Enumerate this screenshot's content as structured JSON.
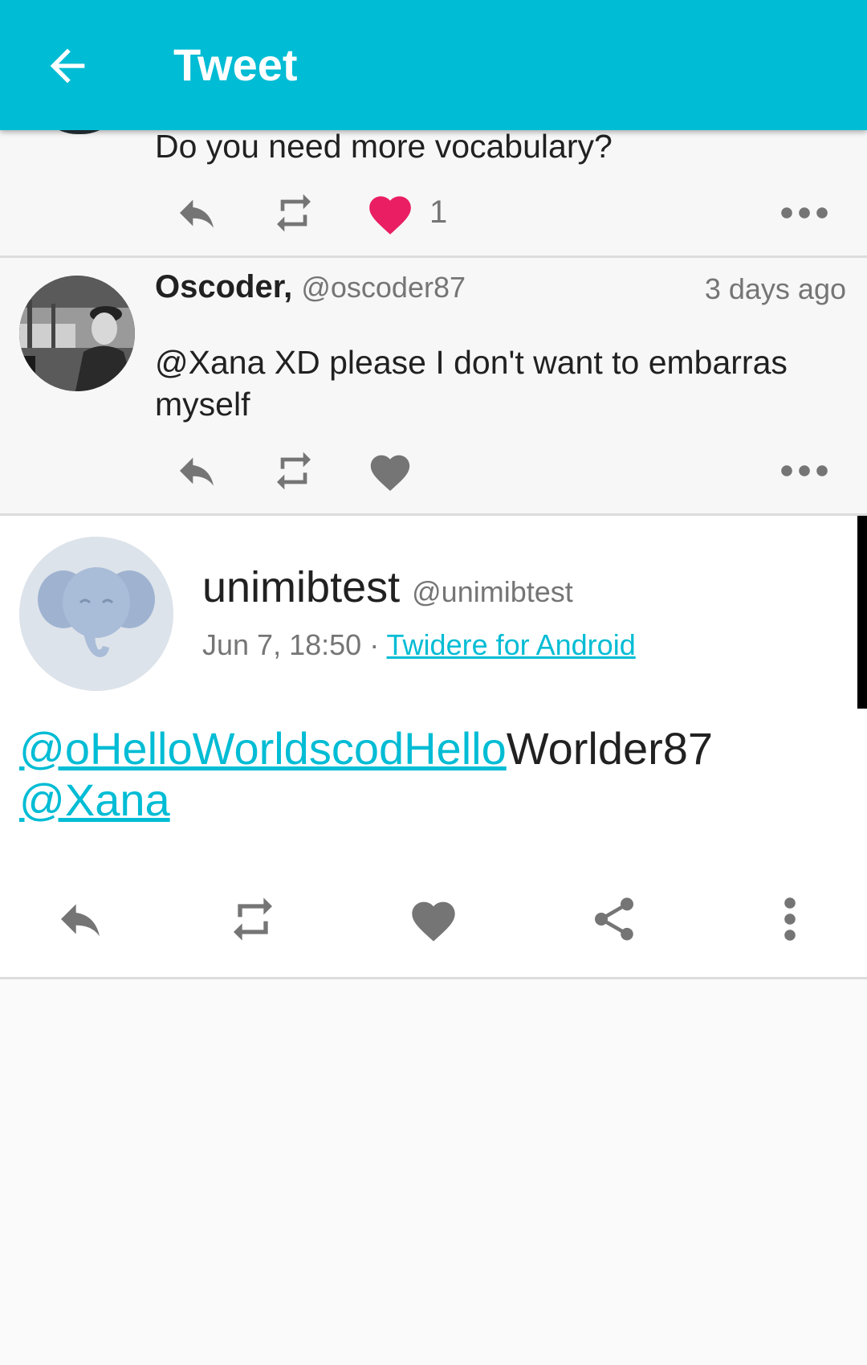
{
  "appbar": {
    "title": "Tweet",
    "back_icon": "arrow-back-icon",
    "color": "#00bcd4"
  },
  "tweet_prev": {
    "text": "Do you need more vocabulary?",
    "like_count": "1",
    "liked": true,
    "like_color": "#e91e63"
  },
  "tweet_reply": {
    "name": "Oscoder,",
    "handle": "@oscoder87",
    "time": "3 days ago",
    "text_line1": "@Xana XD please I don't want to embarras",
    "text_line2": "myself"
  },
  "main_tweet": {
    "name": "unimibtest",
    "handle": "@unimibtest",
    "date": "Jun 7, 18:50",
    "separator": "·",
    "source": "Twidere for Android",
    "mention_link": "@oHelloWorldscodHello",
    "mention_rest": "Worlder87",
    "mention2": "@Xana",
    "link_color": "#00bcd4"
  }
}
